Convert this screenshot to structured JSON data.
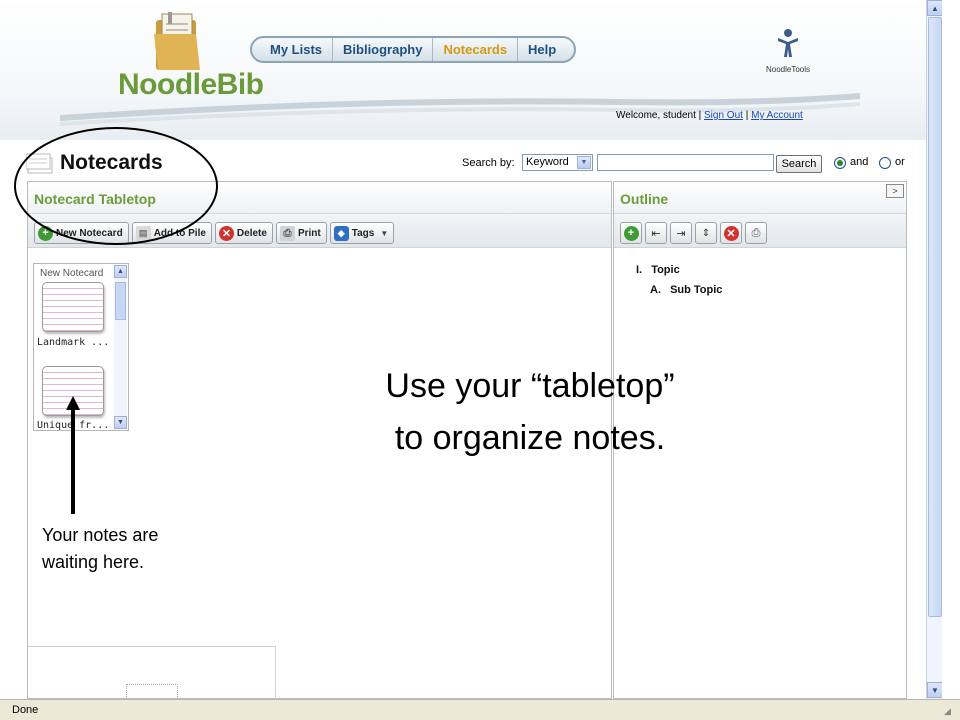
{
  "app": {
    "logo_text": "NoodleBib",
    "noodletools_label": "NoodleTools"
  },
  "nav": {
    "items": [
      {
        "label": "My Lists",
        "active": false
      },
      {
        "label": "Bibliography",
        "active": false
      },
      {
        "label": "Notecards",
        "active": true
      },
      {
        "label": "Help",
        "active": false
      }
    ]
  },
  "user": {
    "welcome": "Welcome, student |",
    "sign_out": "Sign Out",
    "separator": "|",
    "my_account": "My Account"
  },
  "page": {
    "title": "Notecards"
  },
  "search": {
    "label": "Search by:",
    "type_value": "Keyword",
    "query": "",
    "button": "Search",
    "and_label": "and",
    "or_label": "or",
    "mode": "and"
  },
  "tabletop": {
    "title": "Notecard Tabletop",
    "toolbar": {
      "new_notecard": "New Notecard",
      "add_to_pile": "Add to Pile",
      "delete": "Delete",
      "print": "Print",
      "tags": "Tags"
    },
    "pile": {
      "label": "New Notecard",
      "cards": [
        {
          "label": "Landmark ..."
        },
        {
          "label": "Unique fr..."
        }
      ]
    }
  },
  "outline": {
    "title": "Outline",
    "items": [
      {
        "number": "I.",
        "label": "Topic"
      },
      {
        "number": "A.",
        "label": "Sub Topic"
      }
    ]
  },
  "annotations": {
    "callout_line1": "Use your “tabletop”",
    "callout_line2": "to organize notes.",
    "notes_line1": "Your notes are",
    "notes_line2": "waiting here."
  },
  "statusbar": {
    "text": "Done"
  },
  "colors": {
    "brand_green": "#6d9c3a",
    "nav_active": "#d69a10",
    "nav_text": "#1f4f82",
    "link": "#1c46b6"
  }
}
